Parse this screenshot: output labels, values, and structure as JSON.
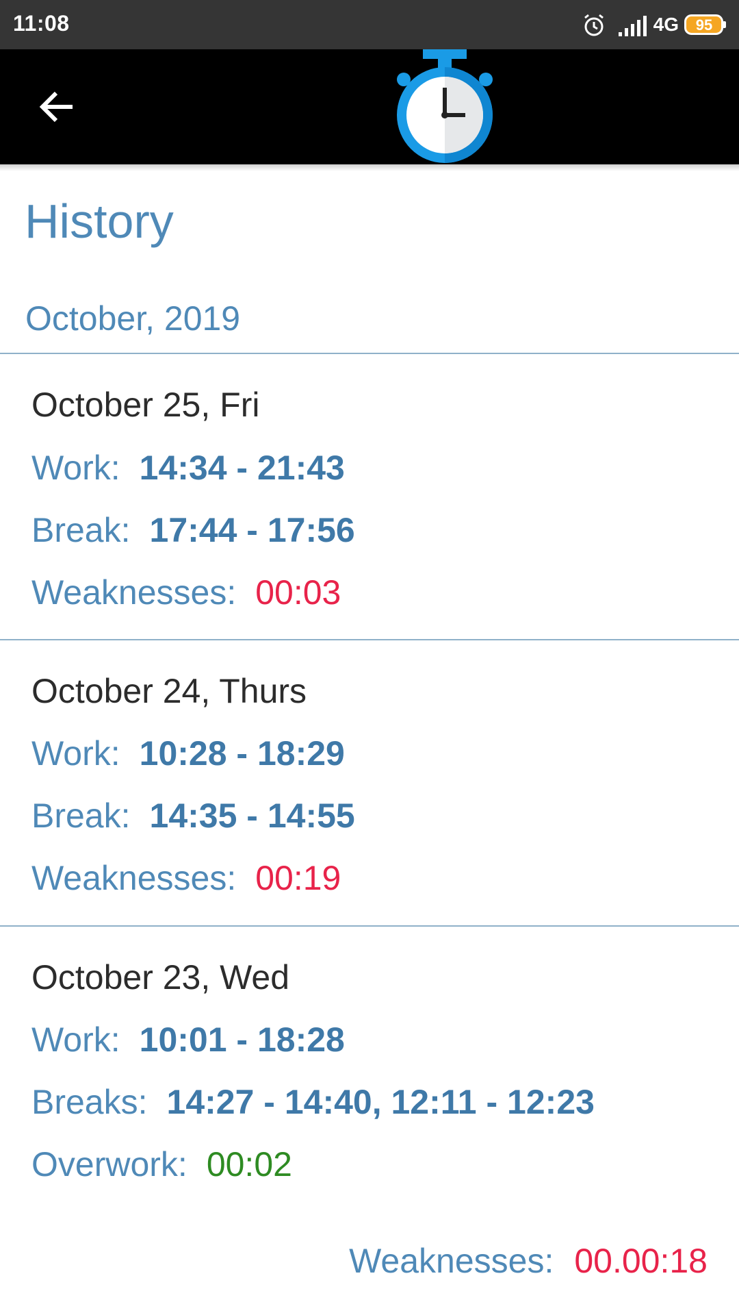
{
  "status_bar": {
    "time": "11:08",
    "network": "4G",
    "battery": "95",
    "icons": [
      "alarm-icon",
      "signal-icon",
      "battery-icon"
    ],
    "battery_color": "#f5a623"
  },
  "app_bar": {
    "back_icon": "arrow-left-icon",
    "logo_icon": "stopwatch-icon",
    "background": "#000000",
    "logo_color": "#1a9be6"
  },
  "page": {
    "title": "History",
    "month": "October, 2019"
  },
  "days": [
    {
      "title": "October 25, Fri",
      "work_label": "Work:",
      "work_value": "14:34 - 21:43",
      "break_label": "Break:",
      "break_value": "17:44 - 17:56",
      "extra_label": "Weaknesses:",
      "extra_value": "00:03"
    },
    {
      "title": "October 24, Thurs",
      "work_label": "Work:",
      "work_value": "10:28 - 18:29",
      "break_label": "Break:",
      "break_value": "14:35 - 14:55",
      "extra_label": "Weaknesses:",
      "extra_value": "00:19"
    },
    {
      "title": "October 23, Wed",
      "work_label": "Work:",
      "work_value": "10:01 - 18:28",
      "break_label": "Breaks:",
      "break_value": "14:27 - 14:40, 12:11 - 12:23",
      "extra_label": "Overwork:",
      "extra_value": "00:02"
    }
  ],
  "total": {
    "label": "Weaknesses:",
    "value": "00.00:18"
  },
  "colors": {
    "label_blue": "#4f89b7",
    "value_blue": "#3f79a8",
    "weakness_red": "#e8234a",
    "overwork_green": "#2e8b22"
  }
}
